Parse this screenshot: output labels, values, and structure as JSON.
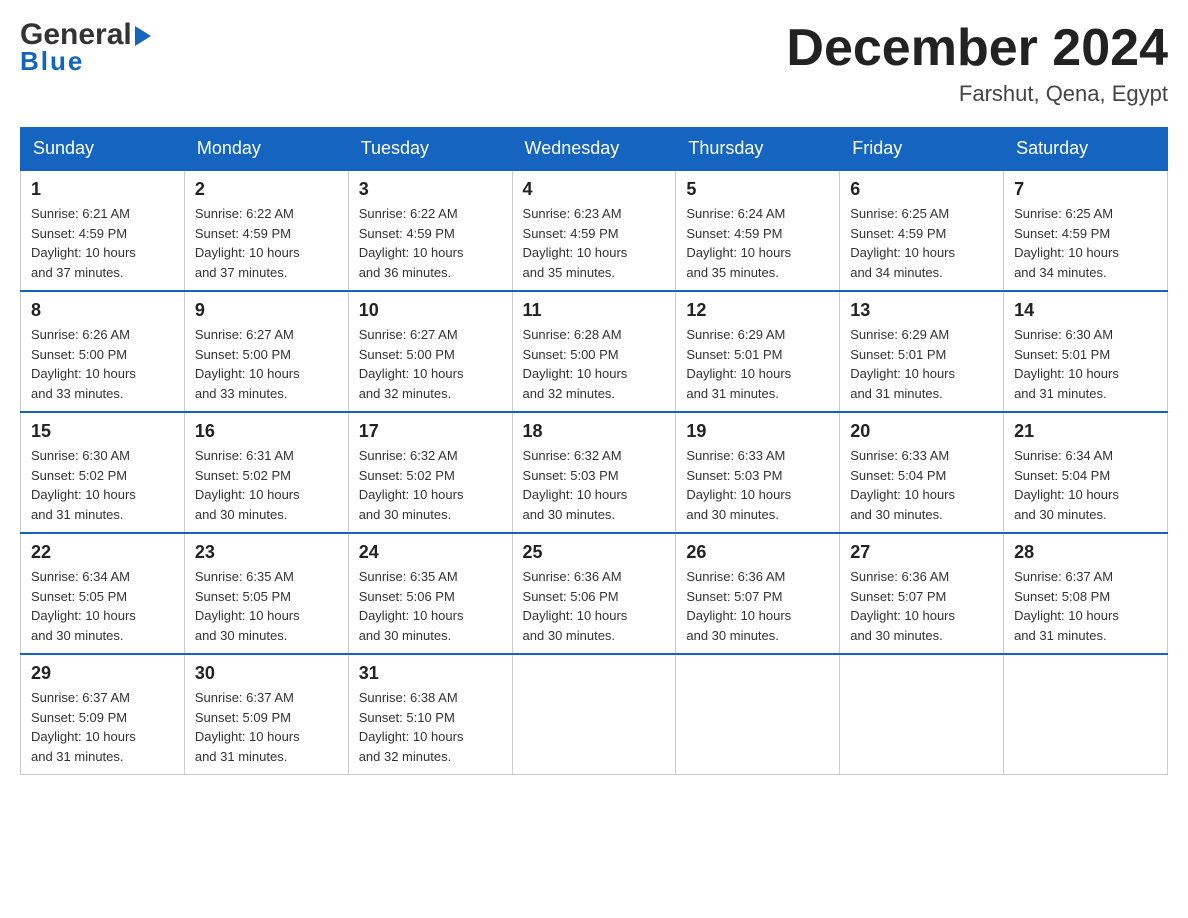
{
  "logo": {
    "general": "General",
    "blue": "Blue"
  },
  "title": {
    "month_year": "December 2024",
    "location": "Farshut, Qena, Egypt"
  },
  "headers": [
    "Sunday",
    "Monday",
    "Tuesday",
    "Wednesday",
    "Thursday",
    "Friday",
    "Saturday"
  ],
  "weeks": [
    [
      {
        "day": "1",
        "sunrise": "6:21 AM",
        "sunset": "4:59 PM",
        "daylight": "10 hours and 37 minutes."
      },
      {
        "day": "2",
        "sunrise": "6:22 AM",
        "sunset": "4:59 PM",
        "daylight": "10 hours and 37 minutes."
      },
      {
        "day": "3",
        "sunrise": "6:22 AM",
        "sunset": "4:59 PM",
        "daylight": "10 hours and 36 minutes."
      },
      {
        "day": "4",
        "sunrise": "6:23 AM",
        "sunset": "4:59 PM",
        "daylight": "10 hours and 35 minutes."
      },
      {
        "day": "5",
        "sunrise": "6:24 AM",
        "sunset": "4:59 PM",
        "daylight": "10 hours and 35 minutes."
      },
      {
        "day": "6",
        "sunrise": "6:25 AM",
        "sunset": "4:59 PM",
        "daylight": "10 hours and 34 minutes."
      },
      {
        "day": "7",
        "sunrise": "6:25 AM",
        "sunset": "4:59 PM",
        "daylight": "10 hours and 34 minutes."
      }
    ],
    [
      {
        "day": "8",
        "sunrise": "6:26 AM",
        "sunset": "5:00 PM",
        "daylight": "10 hours and 33 minutes."
      },
      {
        "day": "9",
        "sunrise": "6:27 AM",
        "sunset": "5:00 PM",
        "daylight": "10 hours and 33 minutes."
      },
      {
        "day": "10",
        "sunrise": "6:27 AM",
        "sunset": "5:00 PM",
        "daylight": "10 hours and 32 minutes."
      },
      {
        "day": "11",
        "sunrise": "6:28 AM",
        "sunset": "5:00 PM",
        "daylight": "10 hours and 32 minutes."
      },
      {
        "day": "12",
        "sunrise": "6:29 AM",
        "sunset": "5:01 PM",
        "daylight": "10 hours and 31 minutes."
      },
      {
        "day": "13",
        "sunrise": "6:29 AM",
        "sunset": "5:01 PM",
        "daylight": "10 hours and 31 minutes."
      },
      {
        "day": "14",
        "sunrise": "6:30 AM",
        "sunset": "5:01 PM",
        "daylight": "10 hours and 31 minutes."
      }
    ],
    [
      {
        "day": "15",
        "sunrise": "6:30 AM",
        "sunset": "5:02 PM",
        "daylight": "10 hours and 31 minutes."
      },
      {
        "day": "16",
        "sunrise": "6:31 AM",
        "sunset": "5:02 PM",
        "daylight": "10 hours and 30 minutes."
      },
      {
        "day": "17",
        "sunrise": "6:32 AM",
        "sunset": "5:02 PM",
        "daylight": "10 hours and 30 minutes."
      },
      {
        "day": "18",
        "sunrise": "6:32 AM",
        "sunset": "5:03 PM",
        "daylight": "10 hours and 30 minutes."
      },
      {
        "day": "19",
        "sunrise": "6:33 AM",
        "sunset": "5:03 PM",
        "daylight": "10 hours and 30 minutes."
      },
      {
        "day": "20",
        "sunrise": "6:33 AM",
        "sunset": "5:04 PM",
        "daylight": "10 hours and 30 minutes."
      },
      {
        "day": "21",
        "sunrise": "6:34 AM",
        "sunset": "5:04 PM",
        "daylight": "10 hours and 30 minutes."
      }
    ],
    [
      {
        "day": "22",
        "sunrise": "6:34 AM",
        "sunset": "5:05 PM",
        "daylight": "10 hours and 30 minutes."
      },
      {
        "day": "23",
        "sunrise": "6:35 AM",
        "sunset": "5:05 PM",
        "daylight": "10 hours and 30 minutes."
      },
      {
        "day": "24",
        "sunrise": "6:35 AM",
        "sunset": "5:06 PM",
        "daylight": "10 hours and 30 minutes."
      },
      {
        "day": "25",
        "sunrise": "6:36 AM",
        "sunset": "5:06 PM",
        "daylight": "10 hours and 30 minutes."
      },
      {
        "day": "26",
        "sunrise": "6:36 AM",
        "sunset": "5:07 PM",
        "daylight": "10 hours and 30 minutes."
      },
      {
        "day": "27",
        "sunrise": "6:36 AM",
        "sunset": "5:07 PM",
        "daylight": "10 hours and 30 minutes."
      },
      {
        "day": "28",
        "sunrise": "6:37 AM",
        "sunset": "5:08 PM",
        "daylight": "10 hours and 31 minutes."
      }
    ],
    [
      {
        "day": "29",
        "sunrise": "6:37 AM",
        "sunset": "5:09 PM",
        "daylight": "10 hours and 31 minutes."
      },
      {
        "day": "30",
        "sunrise": "6:37 AM",
        "sunset": "5:09 PM",
        "daylight": "10 hours and 31 minutes."
      },
      {
        "day": "31",
        "sunrise": "6:38 AM",
        "sunset": "5:10 PM",
        "daylight": "10 hours and 32 minutes."
      },
      null,
      null,
      null,
      null
    ]
  ],
  "sunrise_label": "Sunrise:",
  "sunset_label": "Sunset:",
  "daylight_label": "Daylight:"
}
